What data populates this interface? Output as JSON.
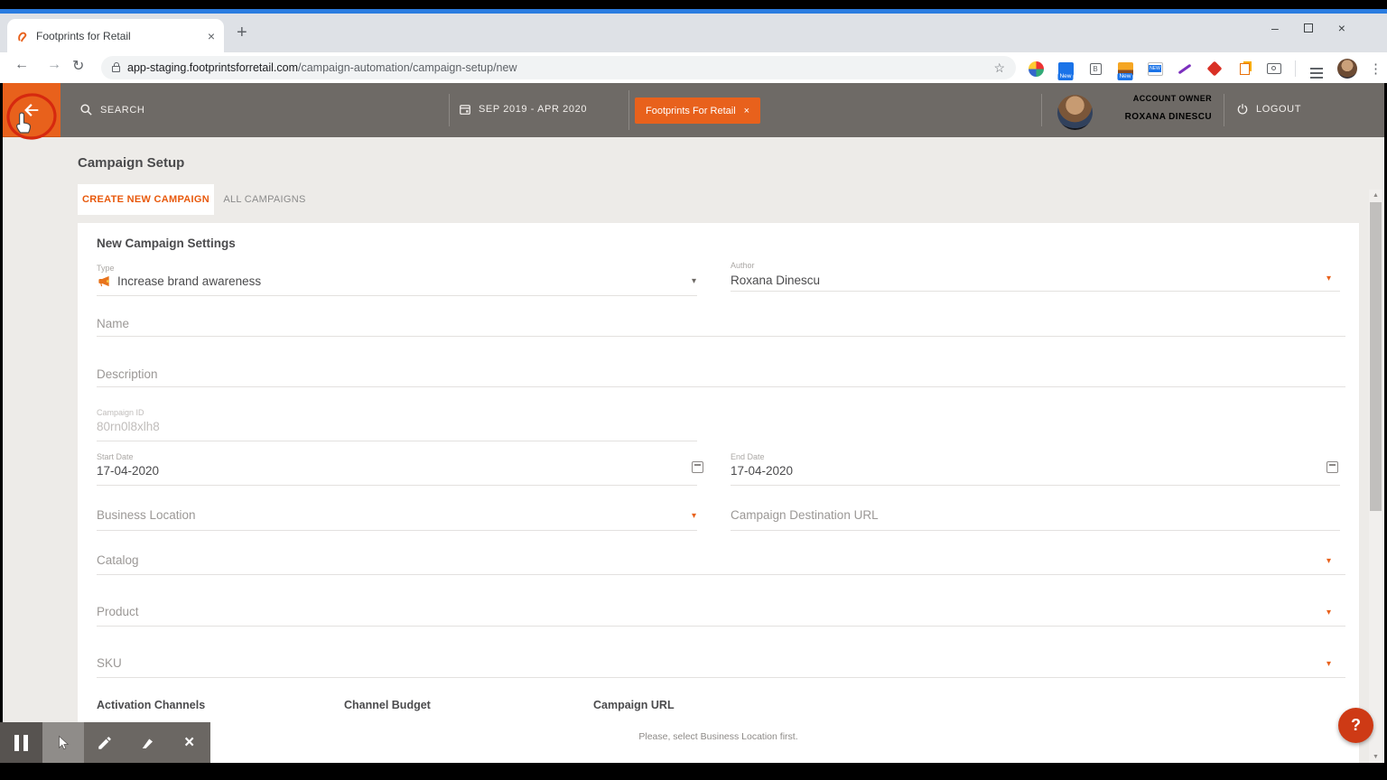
{
  "glyphs": {
    "close": "×",
    "plus": "+",
    "back": "←",
    "forward": "→",
    "reload": "↻",
    "star": "☆",
    "dots": "⋮",
    "caret": "▾",
    "up": "▲",
    "down": "▼",
    "minimize": "–",
    "pause": "❚❚"
  },
  "browser": {
    "tab": {
      "title": "Footprints for Retail",
      "favicon": "footprints-logo"
    },
    "omnibox": {
      "url_domain": "app-staging.footprintsforretail.com",
      "url_path": "/campaign-automation/campaign-setup/new"
    },
    "extensions": [
      "color-wheel",
      "screenshot-new",
      "tag-b",
      "sunset-new",
      "new-banner",
      "purple-pen",
      "red-shape",
      "copy-pages",
      "camera",
      "playlist",
      "profile-avatar",
      "menu-dots"
    ],
    "window_controls": [
      "minimize",
      "maximize",
      "close"
    ]
  },
  "app_header": {
    "search_label": "SEARCH",
    "date_range": "SEP 2019 - APR 2020",
    "filter_chip": {
      "label": "Footprints For Retail"
    },
    "account": {
      "role": "ACCOUNT OWNER",
      "name": "ROXANA DINESCU"
    },
    "logout_label": "LOGOUT"
  },
  "sidebar": {
    "items": [
      "arrow-left-icon",
      "blank",
      "person-icon",
      "megaphone-icon",
      "megaphone-icon",
      "calendar-icon",
      "pencil-icon-active",
      "menu-lines-icon",
      "share-icon",
      "mountain-chart-icon",
      "glass-icon",
      "document-edit-icon"
    ]
  },
  "page": {
    "title": "Campaign Setup",
    "tabs": [
      {
        "label": "CREATE NEW CAMPAIGN",
        "active": true
      },
      {
        "label": "ALL CAMPAIGNS",
        "active": false
      }
    ],
    "form": {
      "section_title": "New Campaign Settings",
      "type": {
        "label": "Type",
        "value": "Increase brand awareness",
        "icon": "megaphone-icon"
      },
      "author": {
        "label": "Author",
        "value": "Roxana Dinescu"
      },
      "name": {
        "placeholder": "Name"
      },
      "description": {
        "placeholder": "Description"
      },
      "campaign_id": {
        "label": "Campaign ID",
        "value": "80rn0l8xlh8"
      },
      "start_date": {
        "label": "Start Date",
        "value": "17-04-2020"
      },
      "end_date": {
        "label": "End Date",
        "value": "17-04-2020"
      },
      "business_location": {
        "placeholder": "Business Location"
      },
      "campaign_destination_url": {
        "placeholder": "Campaign Destination URL"
      },
      "catalog": {
        "placeholder": "Catalog"
      },
      "product": {
        "placeholder": "Product"
      },
      "sku": {
        "placeholder": "SKU"
      },
      "columns": {
        "activation_channels": "Activation Channels",
        "channel_budget": "Channel Budget",
        "campaign_url": "Campaign URL"
      },
      "notice": "Please, select Business Location first."
    }
  },
  "overlay": {
    "toolbar": [
      "pause",
      "cursor",
      "pencil",
      "eraser",
      "close"
    ],
    "help_button": "?"
  },
  "colors": {
    "accent_orange": "#E8611C",
    "sidebar_dark": "#C23A17",
    "header_gray": "#6E6A66",
    "annotation_red": "#D6290F",
    "help_red": "#CE3A15",
    "blue_strip": "#2A7CE0"
  }
}
